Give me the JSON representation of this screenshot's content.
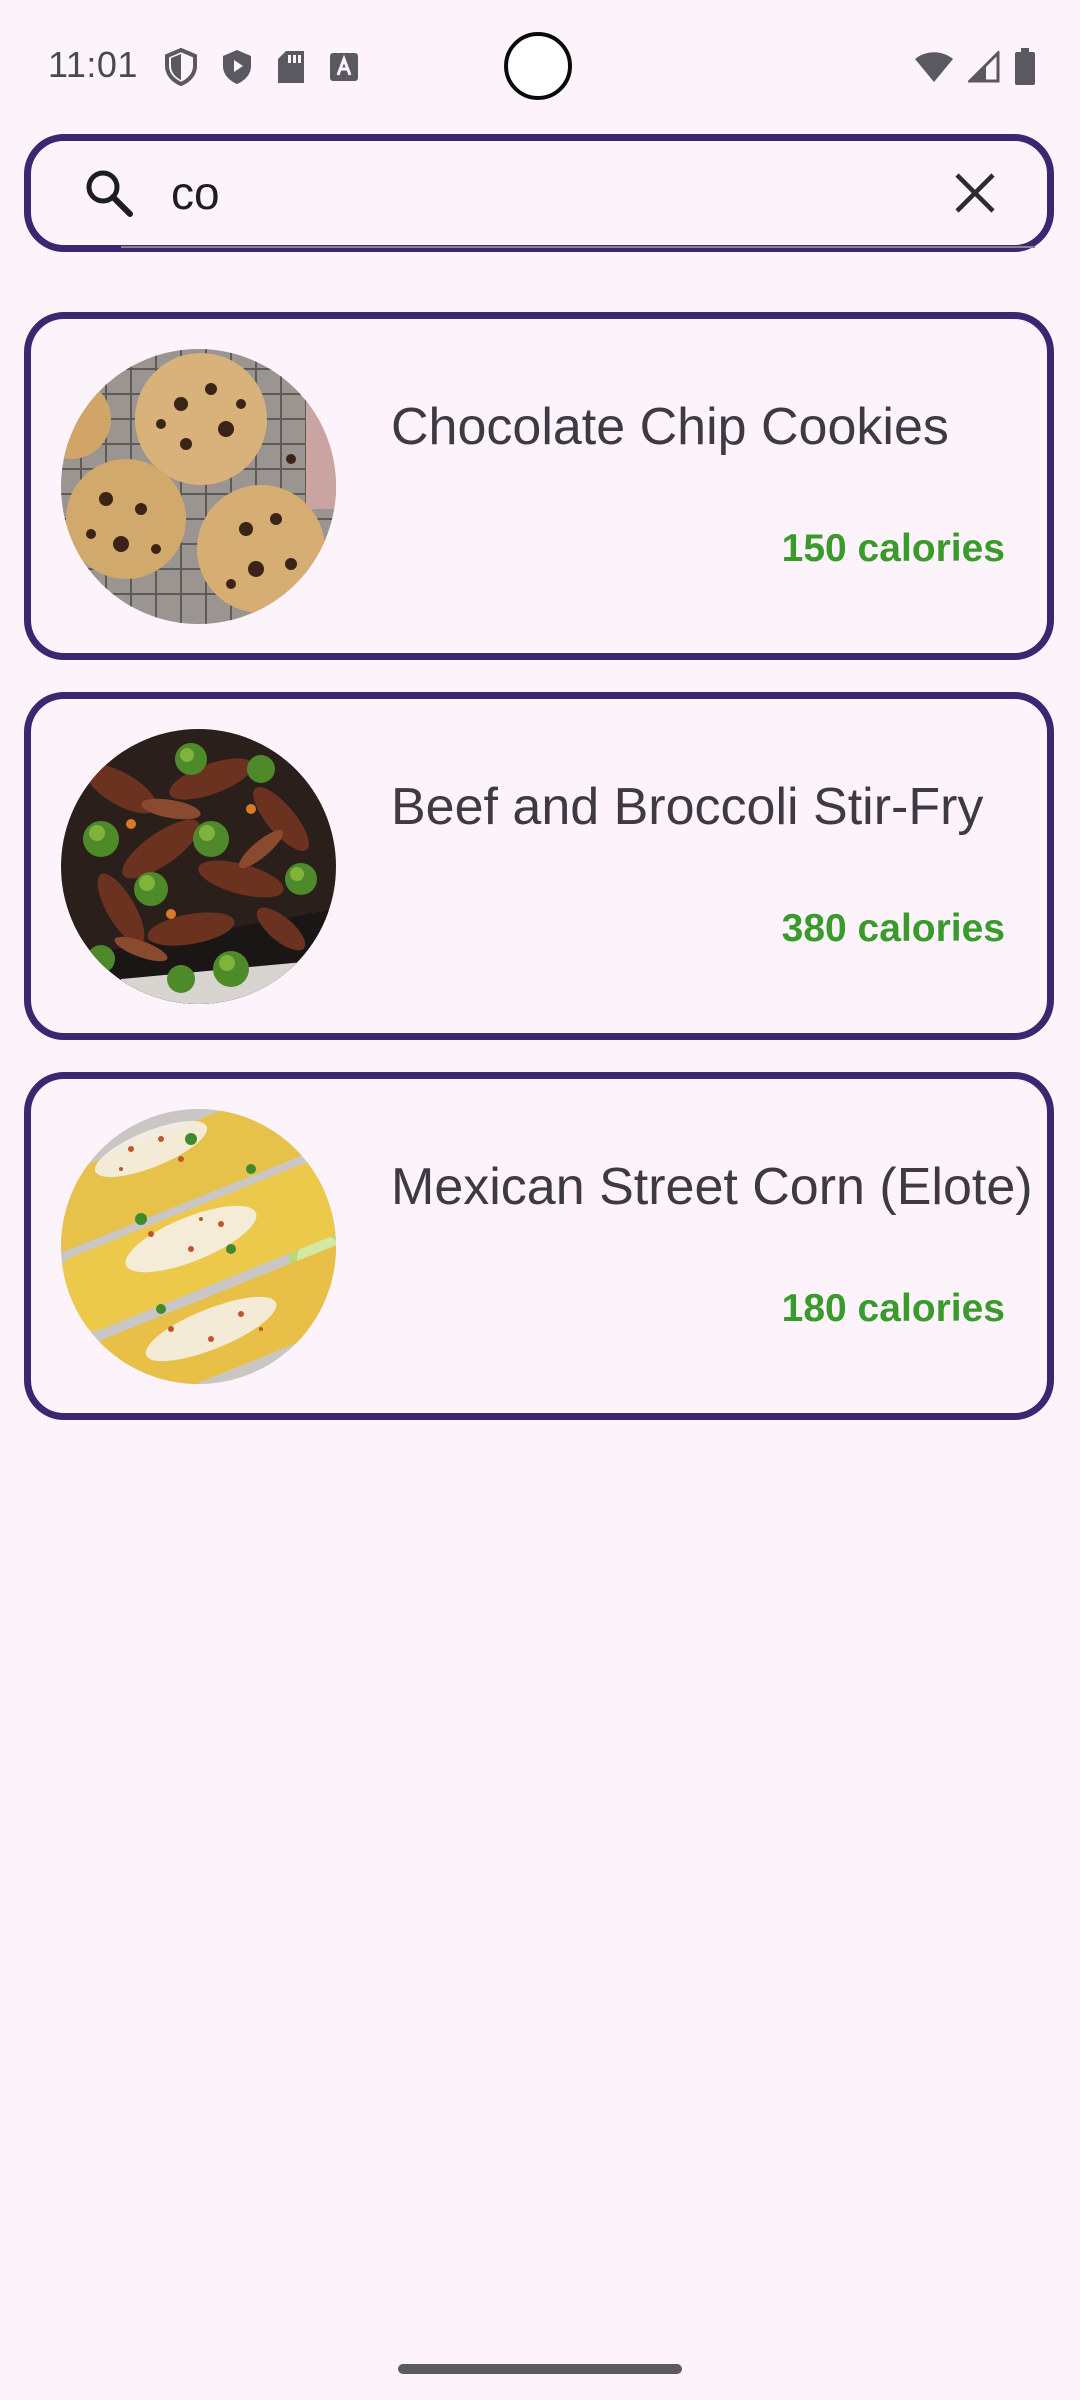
{
  "status_bar": {
    "time": "11:01",
    "left_icons": [
      "shield-outline-icon",
      "shield-play-icon",
      "sd-card-icon",
      "font-a-icon"
    ],
    "right_icons": [
      "wifi-icon",
      "signal-icon",
      "battery-icon"
    ]
  },
  "search": {
    "value": "co",
    "placeholder": "",
    "search_icon": "search-icon",
    "clear_icon": "close-icon"
  },
  "results": [
    {
      "title": "Chocolate Chip Cookies",
      "calories": "150 calories"
    },
    {
      "title": "Beef and Broccoli Stir-Fry",
      "calories": "380 calories"
    },
    {
      "title": "Mexican Street Corn (Elote)",
      "calories": "180 calories"
    }
  ],
  "colors": {
    "background": "#fdf4fb",
    "border": "#3b2770",
    "calories": "#3a9a2b",
    "text": "#3d3a44"
  }
}
